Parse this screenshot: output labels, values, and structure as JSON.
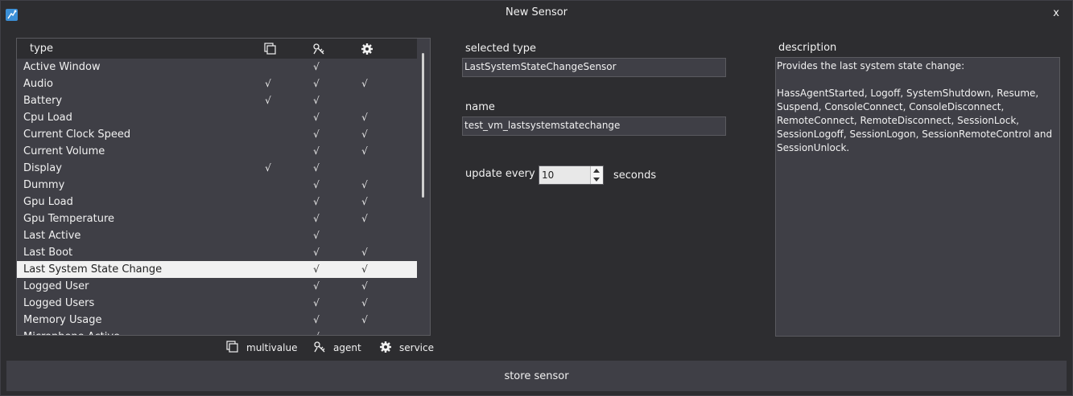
{
  "window": {
    "title": "New Sensor",
    "close_label": "x"
  },
  "list": {
    "header": {
      "type": "type"
    },
    "check_mark": "√",
    "rows": [
      {
        "name": "Active Window",
        "multivalue": "",
        "agent": "√",
        "service": ""
      },
      {
        "name": "Audio",
        "multivalue": "√",
        "agent": "√",
        "service": "√"
      },
      {
        "name": "Battery",
        "multivalue": "√",
        "agent": "√",
        "service": ""
      },
      {
        "name": "Cpu Load",
        "multivalue": "",
        "agent": "√",
        "service": "√"
      },
      {
        "name": "Current Clock Speed",
        "multivalue": "",
        "agent": "√",
        "service": "√"
      },
      {
        "name": "Current Volume",
        "multivalue": "",
        "agent": "√",
        "service": "√"
      },
      {
        "name": "Display",
        "multivalue": "√",
        "agent": "√",
        "service": ""
      },
      {
        "name": "Dummy",
        "multivalue": "",
        "agent": "√",
        "service": "√"
      },
      {
        "name": "Gpu Load",
        "multivalue": "",
        "agent": "√",
        "service": "√"
      },
      {
        "name": "Gpu Temperature",
        "multivalue": "",
        "agent": "√",
        "service": "√"
      },
      {
        "name": "Last Active",
        "multivalue": "",
        "agent": "√",
        "service": ""
      },
      {
        "name": "Last Boot",
        "multivalue": "",
        "agent": "√",
        "service": "√"
      },
      {
        "name": "Last System State Change",
        "multivalue": "",
        "agent": "√",
        "service": "√",
        "selected": true
      },
      {
        "name": "Logged User",
        "multivalue": "",
        "agent": "√",
        "service": "√"
      },
      {
        "name": "Logged Users",
        "multivalue": "",
        "agent": "√",
        "service": "√"
      },
      {
        "name": "Memory Usage",
        "multivalue": "",
        "agent": "√",
        "service": "√"
      },
      {
        "name": "Microphone Active",
        "multivalue": "",
        "agent": "√",
        "service": ""
      }
    ]
  },
  "legend": {
    "multivalue": "multivalue",
    "agent": "agent",
    "service": "service"
  },
  "form": {
    "selected_type_label": "selected type",
    "selected_type_value": "LastSystemStateChangeSensor",
    "name_label": "name",
    "name_value": "test_vm_lastsystemstatechange",
    "update_label": "update every",
    "update_value": "10",
    "update_unit": "seconds"
  },
  "description": {
    "label": "description",
    "text": "Provides the last system state change:\n\nHassAgentStarted, Logoff, SystemShutdown, Resume, Suspend, ConsoleConnect, ConsoleDisconnect, RemoteConnect, RemoteDisconnect, SessionLock, SessionLogoff, SessionLogon, SessionRemoteControl and SessionUnlock."
  },
  "footer": {
    "store_label": "store sensor"
  },
  "colors": {
    "background": "#2d2d30",
    "panel": "#3f3f46",
    "selected_row": "#f1f1f1",
    "text": "#f1f1f1"
  }
}
